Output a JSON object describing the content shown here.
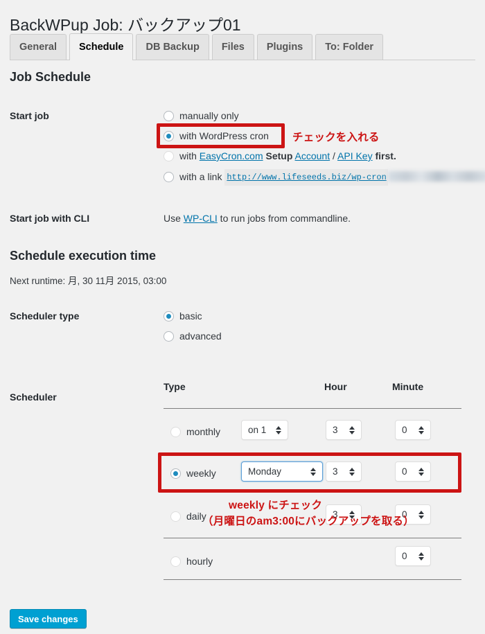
{
  "page": {
    "title": "BackWPup Job: バックアップ01",
    "save_label": "Save changes"
  },
  "tabs": [
    {
      "label": "General",
      "active": false
    },
    {
      "label": "Schedule",
      "active": true
    },
    {
      "label": "DB Backup",
      "active": false
    },
    {
      "label": "Files",
      "active": false
    },
    {
      "label": "Plugins",
      "active": false
    },
    {
      "label": "To: Folder",
      "active": false
    }
  ],
  "sections": {
    "job_schedule": "Job Schedule",
    "execution_time": "Schedule execution time",
    "next_runtime": "Next runtime: 月, 30 11月 2015, 03:00"
  },
  "start_job": {
    "label": "Start job",
    "options": {
      "manually": "manually only",
      "wp_cron": "with WordPress cron",
      "easycron_prefix": "with ",
      "easycron_link": "EasyCron.com",
      "easycron_setup": "Setup",
      "easycron_account": "Account",
      "easycron_sep": "/",
      "easycron_apikey": "API Key",
      "easycron_suffix": "first.",
      "link_label": "with a link",
      "link_url": "http://www.lifeseeds.biz/wp-cron"
    },
    "selected": "wp_cron"
  },
  "start_job_cli": {
    "label": "Start job with CLI",
    "text_before": "Use ",
    "link": "WP-CLI",
    "text_after": " to run jobs from commandline."
  },
  "scheduler_type": {
    "label": "Scheduler type",
    "options": {
      "basic": "basic",
      "advanced": "advanced"
    },
    "selected": "basic"
  },
  "scheduler": {
    "label": "Scheduler",
    "columns": {
      "type": "Type",
      "hour": "Hour",
      "minute": "Minute"
    },
    "selected": "weekly",
    "rows": [
      {
        "type": "monthly",
        "day": "on 1",
        "hour": "3",
        "minute": "0",
        "checked": false
      },
      {
        "type": "weekly",
        "day": "Monday",
        "hour": "3",
        "minute": "0",
        "checked": true
      },
      {
        "type": "daily",
        "day": "",
        "hour": "3",
        "minute": "0",
        "checked": false
      },
      {
        "type": "hourly",
        "day": "",
        "hour": "",
        "minute": "0",
        "checked": false
      }
    ]
  },
  "annotations": {
    "cron_check": "チェックを入れる",
    "weekly_check_line1": "weekly にチェック",
    "weekly_check_line2": "（月曜日のam3:00にバックアップを取る）"
  },
  "colors": {
    "accent_blue": "#00a0d2",
    "radio_blue": "#1e8cbe",
    "link_blue": "#0073aa",
    "annotation_red": "#cc1414",
    "page_bg": "#f1f1f1"
  }
}
